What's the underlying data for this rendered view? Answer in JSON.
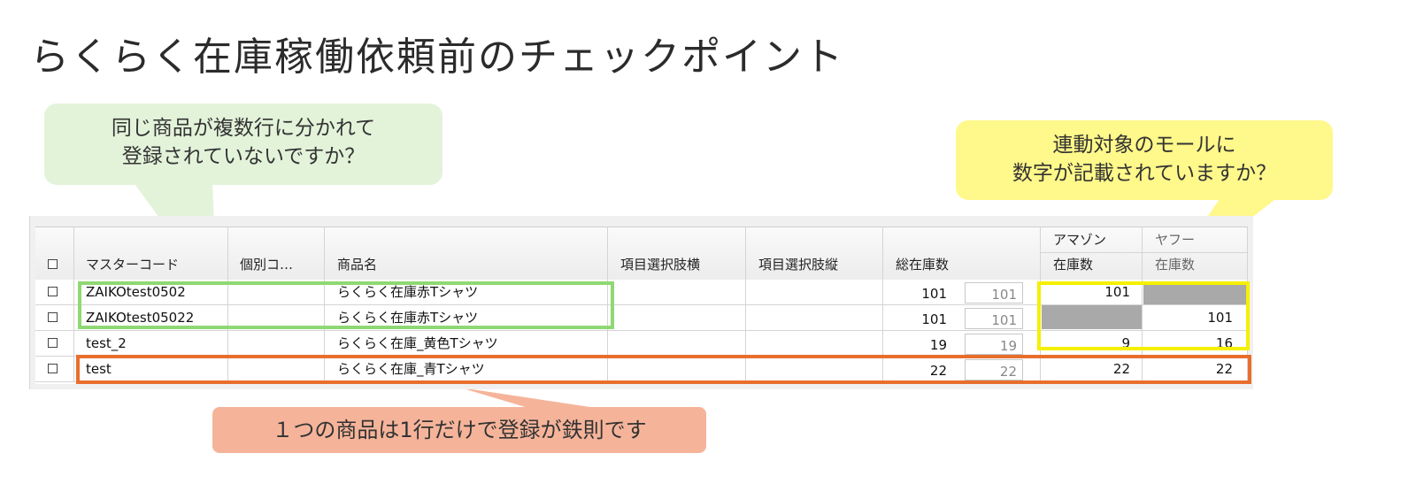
{
  "title": "らくらく在庫稼働依頼前のチェックポイント",
  "callouts": {
    "green_line1": "同じ商品が複数行に分かれて",
    "green_line2": "登録されていないですか？",
    "yellow_line1": "連動対象のモールに",
    "yellow_line2": "数字が記載されていますか？",
    "orange": "１つの商品は1行だけで登録が鉄則です"
  },
  "table": {
    "columns": {
      "master_code": "マスターコード",
      "individual_code": "個別コ…",
      "product_name": "商品名",
      "option_horizontal": "項目選択肢横",
      "option_vertical": "項目選択肢縦",
      "total_stock": "総在庫数",
      "amazon": "アマゾン",
      "amazon_stock": "在庫数",
      "yahoo": "ヤフー",
      "yahoo_stock": "在庫数"
    },
    "rows": [
      {
        "master_code": "ZAIKOtest0502",
        "product_name": "らくらく在庫赤Tシャツ",
        "total": "101",
        "total_sub": "101",
        "amazon": "101",
        "yahoo": "",
        "amazon_empty": false,
        "yahoo_empty": true
      },
      {
        "master_code": "ZAIKOtest05022",
        "product_name": "らくらく在庫赤Tシャツ",
        "total": "101",
        "total_sub": "101",
        "amazon": "",
        "yahoo": "101",
        "amazon_empty": true,
        "yahoo_empty": false
      },
      {
        "master_code": "test_2",
        "product_name": "らくらく在庫_黄色Tシャツ",
        "total": "19",
        "total_sub": "19",
        "amazon": "9",
        "yahoo": "16",
        "amazon_empty": false,
        "yahoo_empty": false
      },
      {
        "master_code": "test",
        "product_name": "らくらく在庫_青Tシャツ",
        "total": "22",
        "total_sub": "22",
        "amazon": "22",
        "yahoo": "22",
        "amazon_empty": false,
        "yahoo_empty": false
      }
    ]
  },
  "colors": {
    "green_highlight": "#8fd873",
    "yellow_highlight": "#f5f000",
    "orange_highlight": "#e86e2e",
    "empty_cell": "#a9a9a9"
  }
}
